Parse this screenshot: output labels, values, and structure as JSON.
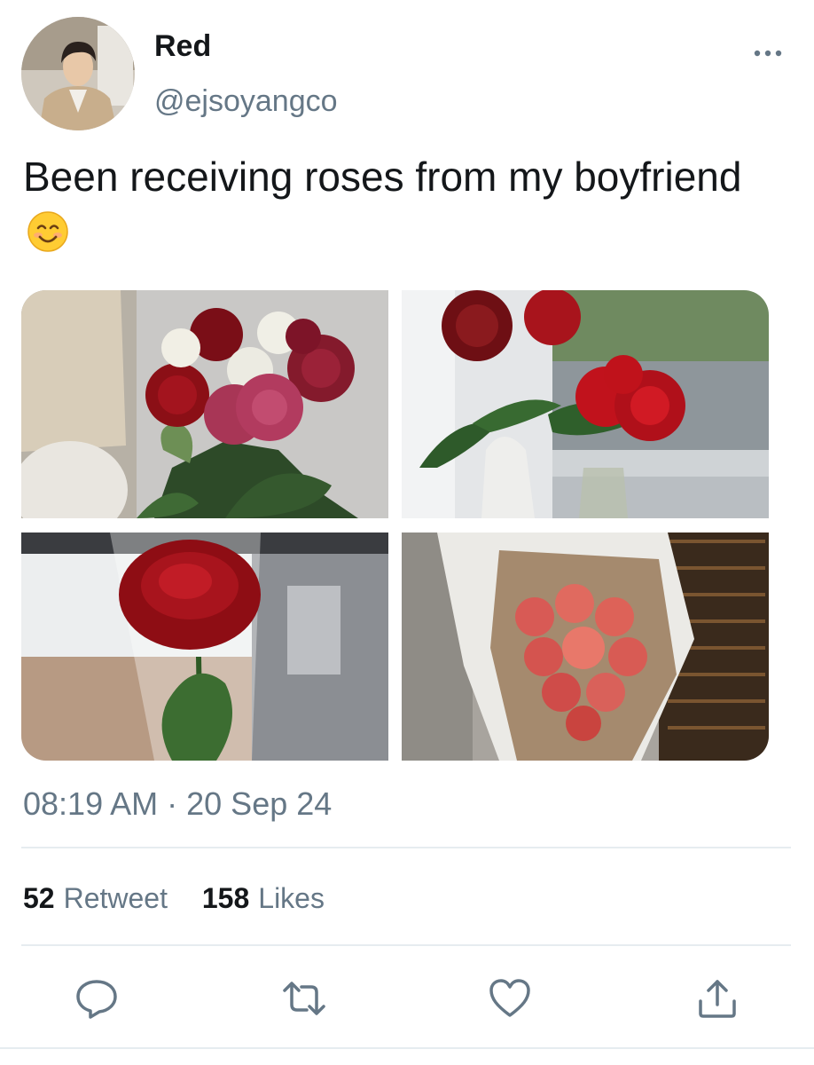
{
  "tweet": {
    "display_name": "Red",
    "handle": "@ejsoyangco",
    "text": "Been receiving roses from my boyfriend",
    "emoji": "smiling-face-emoji",
    "time": "08:19 AM",
    "separator": "·",
    "date": "20 Sep 24"
  },
  "stats": {
    "retweets_count": "52",
    "retweets_label": "Retweet",
    "likes_count": "158",
    "likes_label": "Likes"
  },
  "media": [
    {
      "icon": "red-and-pink-roses-bouquet-photo"
    },
    {
      "icon": "red-roses-in-vases-by-window-photo"
    },
    {
      "icon": "single-red-rose-in-plastic-sleeve-photo"
    },
    {
      "icon": "coral-roses-wrapped-in-paper-photo"
    }
  ],
  "actions": [
    "reply-icon",
    "retweet-icon",
    "like-icon",
    "share-icon"
  ],
  "colors": {
    "text_primary": "#14171a",
    "text_secondary": "#657786",
    "divider": "#e6ecf0",
    "icon": "#657786"
  }
}
